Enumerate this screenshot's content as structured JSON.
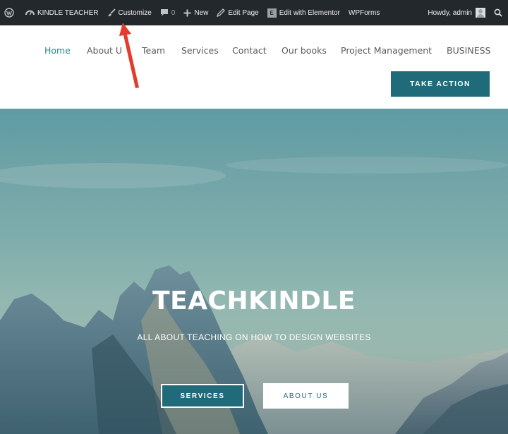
{
  "admin_bar": {
    "site_name": "KINDLE TEACHER",
    "customize": "Customize",
    "comments_count": "0",
    "new_label": "New",
    "edit_page": "Edit Page",
    "elementor_badge": "E",
    "edit_elementor": "Edit with Elementor",
    "wpforms": "WPForms",
    "howdy": "Howdy, admin",
    "icons": [
      "wordpress-icon",
      "dashboard-icon",
      "brush-icon",
      "comment-icon",
      "plus-icon",
      "pencil-icon",
      "elementor-icon",
      "avatar",
      "search-icon"
    ]
  },
  "nav": {
    "items": [
      "Home",
      "About U",
      "Team",
      "Services",
      "Contact",
      "Our books",
      "Project Management",
      "BUSINESS"
    ],
    "active": "Home"
  },
  "header": {
    "cta_label": "TAKE ACTION"
  },
  "hero": {
    "title": "TEACHKINDLE",
    "subtitle": "ALL ABOUT TEACHING ON HOW TO DESIGN WEBSITES",
    "primary_button": "SERVICES",
    "secondary_button": "ABOUT US"
  },
  "colors": {
    "admin_bar_bg": "#23282d",
    "accent": "#1f6b79",
    "nav_active": "#2c8a8a",
    "annotation_arrow": "#e53b2c"
  }
}
